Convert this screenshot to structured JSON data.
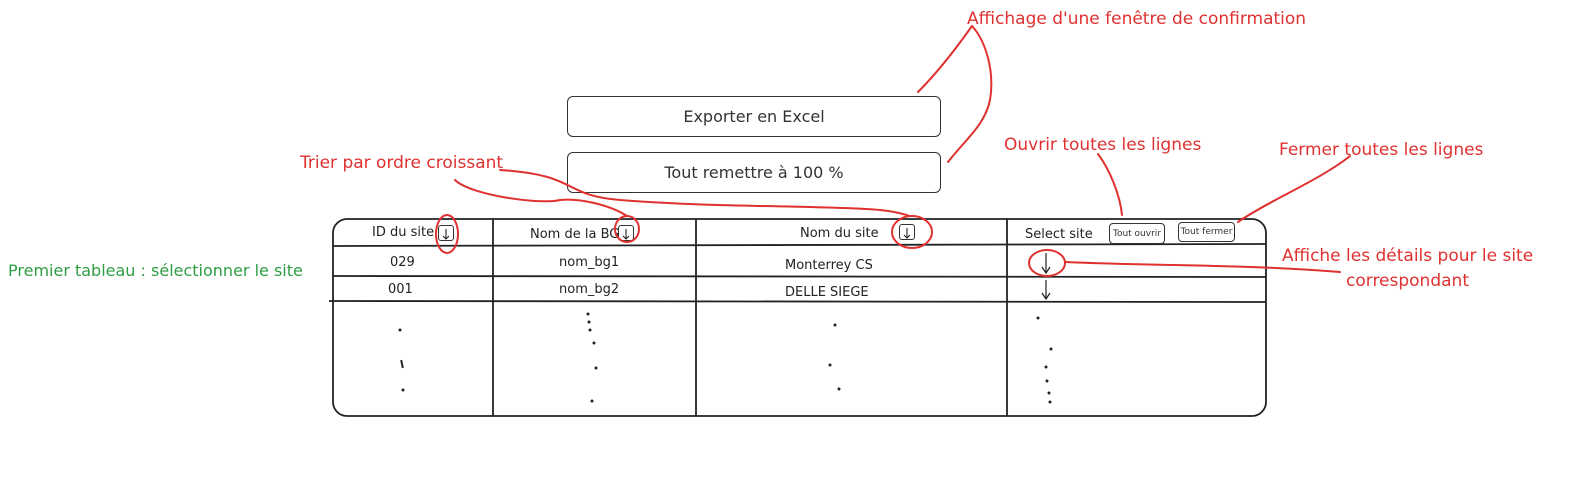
{
  "buttons": {
    "export": "Exporter en Excel",
    "reset": "Tout remettre à 100 %",
    "open_all": "Tout ouvrir",
    "close_all": "Tout fermer"
  },
  "table": {
    "headers": [
      "ID du site",
      "Nom de la BG",
      "Nom du site",
      "Select site"
    ],
    "rows": [
      {
        "id": "029",
        "bg": "nom_bg1",
        "site": "Monterrey CS"
      },
      {
        "id": "001",
        "bg": "nom_bg2",
        "site": "DELLE SIEGE"
      }
    ]
  },
  "annotations": {
    "confirm": "Affichage d'une fenêtre de confirmation",
    "sort": "Trier par ordre croissant",
    "open_all": "Ouvrir toutes les lignes",
    "close_all": "Fermer toutes les lignes",
    "details_line1": "Affiche les détails pour le site",
    "details_line2": "correspondant",
    "first_table": "Premier tableau : sélectionner le site"
  },
  "colors": {
    "annotation": "#e03131",
    "green_note": "#2f9e44",
    "ink": "#333333"
  },
  "icons": [
    "sort-arrow-down-icon",
    "expand-arrow-down-icon"
  ]
}
